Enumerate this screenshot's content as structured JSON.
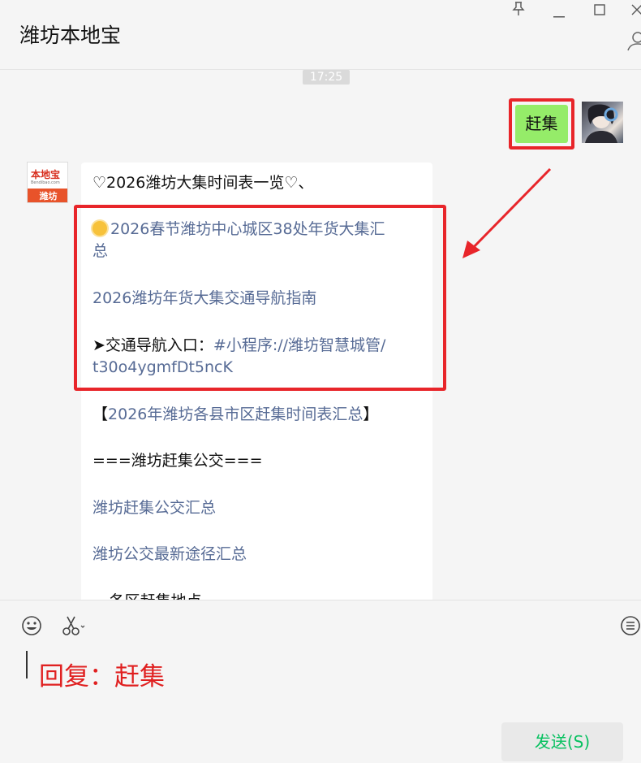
{
  "header": {
    "title": "潍坊本地宝"
  },
  "chat": {
    "time": "17:25",
    "my_message": "赶集",
    "bot_avatar": {
      "logo": "本地宝",
      "url": "Bendibao.com",
      "city": "潍坊"
    },
    "bot_lines": [
      "♡2026潍坊大集时间表一览♡、",
      "2026春节潍坊中心城区38处年货大集汇",
      "总",
      "2026潍坊年货大集交通导航指南",
      "➤交通导航入口：",
      "#小程序://潍坊智慧城管/",
      "t30o4ygmfDt5ncK",
      "【",
      "2026年潍坊各县市区赶集时间表汇总",
      "】",
      "===潍坊赶集公交===",
      "潍坊赶集公交汇总",
      "潍坊公交最新途径汇总",
      "---各区赶集地点---"
    ]
  },
  "input": {
    "text": "回复：赶集",
    "send_label": "发送(S)"
  },
  "colors": {
    "link": "#576b95",
    "highlight": "#e8252a",
    "bubble_me": "#95ec69",
    "send_text": "#07c160"
  }
}
